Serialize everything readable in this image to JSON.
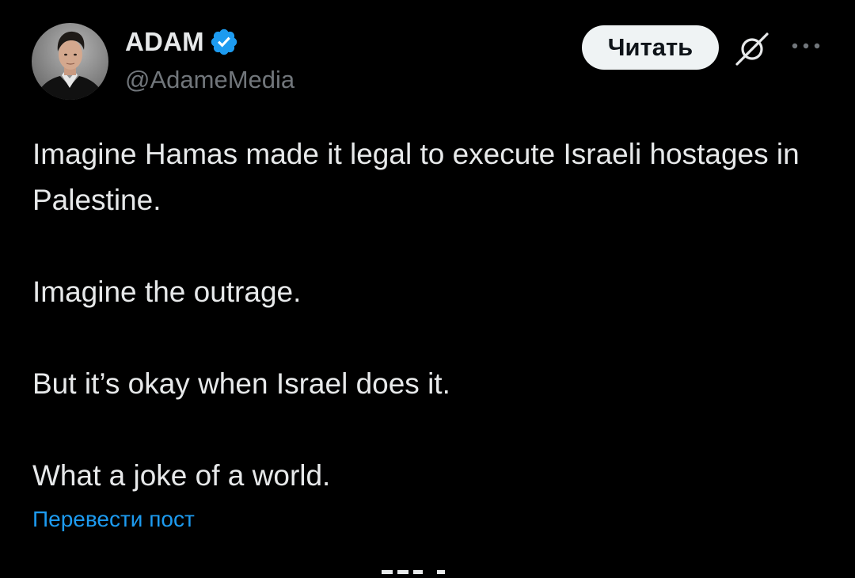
{
  "author": {
    "display_name": "ADAM",
    "handle": "@AdameMedia",
    "verified": true,
    "verified_color": "#1d9bf0"
  },
  "actions": {
    "read_label": "Читать",
    "grok_icon": "grok-icon",
    "more_icon": "more-horizontal-icon"
  },
  "tweet": {
    "paragraphs": [
      "Imagine Hamas made it legal to execute Israeli hostages in Palestine.",
      "Imagine the outrage.",
      "But it’s okay when Israel does it.",
      "What a joke of a world."
    ],
    "translate_label": "Перевести пост"
  },
  "colors": {
    "background": "#000000",
    "text": "#e7e9ea",
    "secondary_text": "#71767b",
    "link": "#1d9bf0",
    "button_bg": "#eff3f4"
  }
}
